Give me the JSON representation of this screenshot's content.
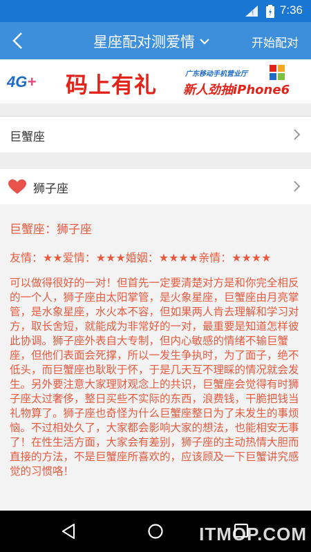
{
  "status": {
    "time": "7:36"
  },
  "app_bar": {
    "title": "星座配对测爱情",
    "action_label": "开始配对"
  },
  "banner": {
    "tag_4g": "4G",
    "tag_plus": "+",
    "main_text": "码上有礼",
    "sub_text_top": "广东移动手机营业厅",
    "sub_text_bottom": "新人劲抽iPhone6"
  },
  "selectors": {
    "first_sign": "巨蟹座",
    "second_sign": "狮子座"
  },
  "result": {
    "pair_title": "巨蟹座：狮子座",
    "ratings": "友情：★★爱情：★★★婚姻：★★★★亲情：★★★★",
    "description": "可以做得很好的一对！但首先一定要清楚对方是和你完全相反的一个人，狮子座由太阳掌管，是火象星座，巨蟹座由月亮掌管，是水象星座，水火本不容，但如果两人肯去理解和学习对方，取长舍短，就能成为非常好的一对，最重要是知道怎样彼此协调。狮子座外表自大专制，但内心敏感的情绪不输巨蟹座，但他们表面会死撑，所以一发生争执时，为了面子，绝不低头，而巨蟹座也耿耿于怀，于是几天互不理睬的情况就会发生。另外要注意大家理财观念上的共识，巨蟹座会觉得有时狮子座太过奢侈，整日买些不实际的东西，浪费钱，干脆把钱当礼物算了。狮子座也奇怪为什么巨蟹座整日为了未发生的事烦恼。不过相处久了，大家都会影响大家的想法，也能相安无事了！在性生活方面，大家会有差别，狮子座的主动热情大胆而直接的方法，不是巨蟹座所喜欢的，应该顾及一下巨蟹讲究感觉的习惯咯！"
  },
  "watermark": "ITMOP.COM",
  "colors": {
    "app_bar": "#3d8fdc",
    "status_bar": "#1976d2",
    "result_text": "#e85a3f",
    "heart": "#e8524a"
  }
}
